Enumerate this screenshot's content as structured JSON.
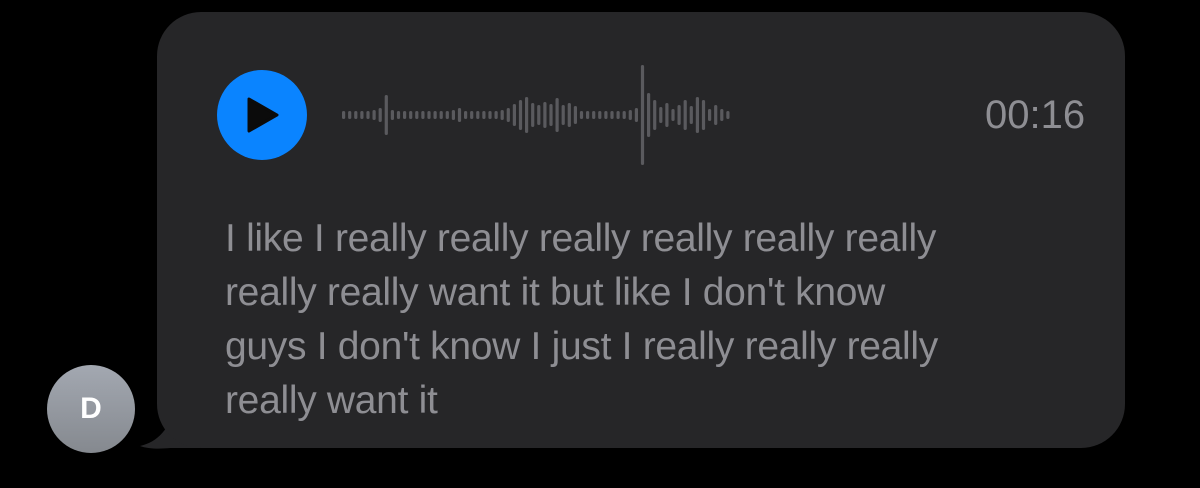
{
  "avatar": {
    "initial": "D",
    "color": "#8e9196"
  },
  "message": {
    "bubble_color": "#262628",
    "audio": {
      "play_icon": "play-icon",
      "accent_color": "#0a84ff",
      "duration": "00:16",
      "waveform_color": "#5a5a5e"
    },
    "transcript_lines": [
      "I like I really really really really really really",
      "really really want it but like I don't know",
      "guys I don't know I just I really really really",
      "really want it"
    ]
  }
}
